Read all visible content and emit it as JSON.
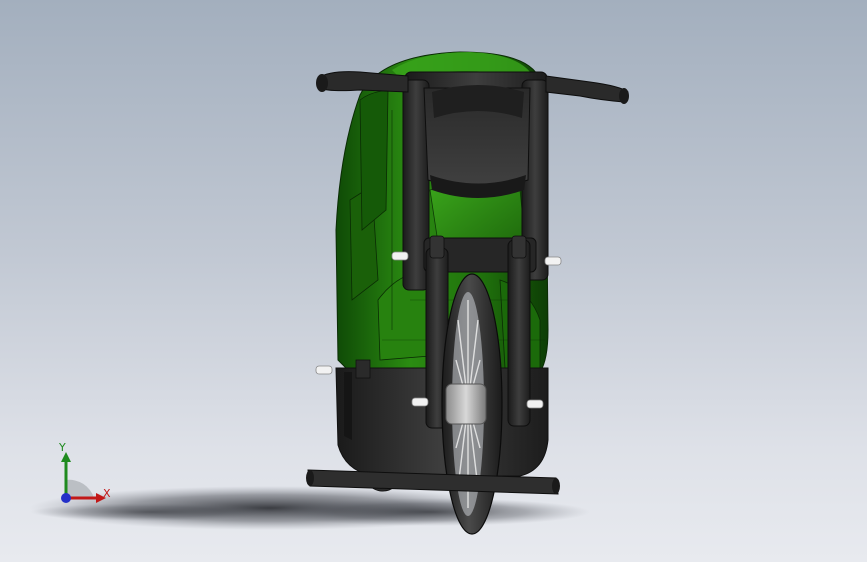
{
  "viewport": {
    "background_top": "#a3afbe",
    "background_bottom": "#e8eaef"
  },
  "model": {
    "body_color": "#2b8c12",
    "frame_color": "#2e2e2e",
    "pin_color": "#f2f2f2"
  },
  "triad": {
    "x_label": "X",
    "y_label": "Y",
    "x_color": "#c21818",
    "y_color": "#1e8a1e",
    "z_color": "#2430c8"
  }
}
